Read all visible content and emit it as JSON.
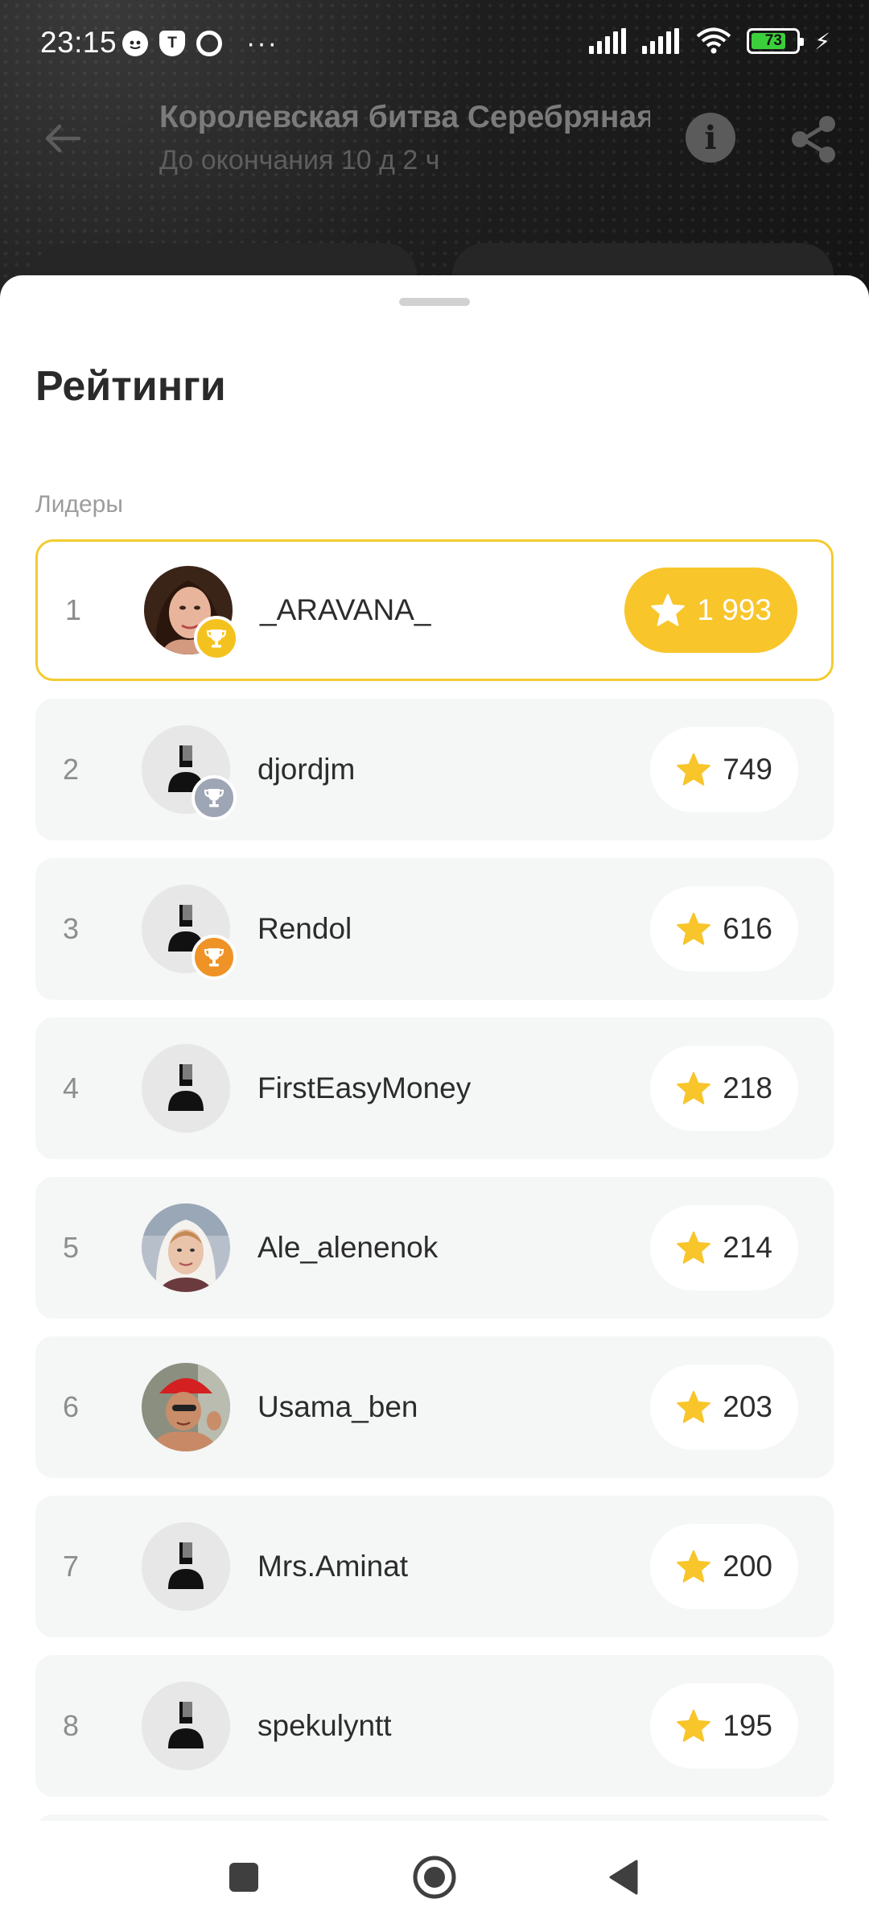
{
  "status_bar": {
    "time": "23:15",
    "notif_t": "T",
    "notif_more": "···",
    "battery": "73"
  },
  "app_bar": {
    "title": "Королевская битва Серебряная",
    "subtitle": "До окончания 10 д 2 ч",
    "info_label": "i"
  },
  "sheet": {
    "title": "Рейтинги",
    "section": "Лидеры"
  },
  "leaders": [
    {
      "rank": "1",
      "name": "_ARAVANA_",
      "score": "1 993",
      "medal": "gold",
      "avatar": "photo-brunette"
    },
    {
      "rank": "2",
      "name": "djordjm",
      "score": "749",
      "medal": "silver",
      "avatar": "default"
    },
    {
      "rank": "3",
      "name": "Rendol",
      "score": "616",
      "medal": "bronze",
      "avatar": "default"
    },
    {
      "rank": "4",
      "name": "FirstEasyMoney",
      "score": "218",
      "medal": "",
      "avatar": "default"
    },
    {
      "rank": "5",
      "name": "Ale_alenenok",
      "score": "214",
      "medal": "",
      "avatar": "photo-blonde"
    },
    {
      "rank": "6",
      "name": "Usama_ben",
      "score": "203",
      "medal": "",
      "avatar": "photo-man"
    },
    {
      "rank": "7",
      "name": "Mrs.Aminat",
      "score": "200",
      "medal": "",
      "avatar": "default"
    },
    {
      "rank": "8",
      "name": "spekulyntt",
      "score": "195",
      "medal": "",
      "avatar": "default"
    }
  ],
  "colors": {
    "accent": "#f8c52b",
    "leader_border": "#f3cb31",
    "row_bg": "#f5f6f6",
    "star": "#f8c52b",
    "medal_gold": "#f4c21f",
    "medal_silver": "#9ea5b5",
    "medal_bronze": "#ef9326"
  },
  "icons": {
    "back": "arrow-left-icon",
    "info": "info-icon",
    "share": "share-icon",
    "star": "star-icon",
    "trophy": "trophy-icon",
    "nav_recents": "square-icon",
    "nav_home": "circle-icon",
    "nav_back": "triangle-back-icon"
  }
}
